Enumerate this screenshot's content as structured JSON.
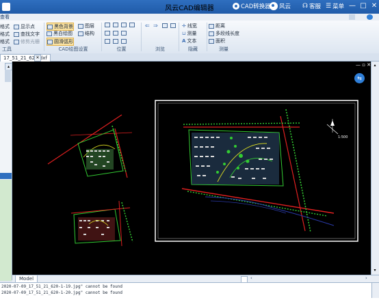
{
  "titlebar": {
    "title": "风云CAD编辑器",
    "converter_label": "CAD转换器",
    "fengyun_label": "风云",
    "service_label": "客服",
    "menu_label": "菜单",
    "minimize": "—",
    "maximize": "□",
    "close": "✕"
  },
  "tabs": {
    "view": "查看"
  },
  "ribbon": {
    "tools": {
      "label": "工具",
      "items": [
        "显示点",
        "查找文字",
        "修剪光栅"
      ],
      "left_cut": [
        "格式",
        "格式",
        "格式"
      ]
    },
    "draw_settings": {
      "label": "CAD绘图设置",
      "items": [
        "黑色背景",
        "黑白绘图",
        "圆滑弧形",
        "图层",
        "结构"
      ]
    },
    "position": {
      "label": "位置"
    },
    "browse": {
      "label": "浏览"
    },
    "hide": {
      "label": "隐藏",
      "items": [
        "线宽",
        "测量",
        "文本"
      ]
    },
    "measure": {
      "label": "测量",
      "items": [
        "距离",
        "多段线长度",
        "面积"
      ]
    }
  },
  "document": {
    "tab_label": "17_51_21_620.dxf",
    "close": "✕"
  },
  "canvas": {
    "model_tab": "Model",
    "north_label": "1:500",
    "controls": "— ▫ ✕",
    "float_button": "⇆"
  },
  "command_line": {
    "lines": [
      "2020-07-09_17_51_21_620-1-19.jpg\" cannot be found",
      "2020-07-09_17_51_21_620-1-20.jpg\" cannot be found"
    ]
  },
  "colors": {
    "titlebar": "#1f5aa8",
    "canvas": "#000000",
    "accent": "#2f7fd8"
  }
}
